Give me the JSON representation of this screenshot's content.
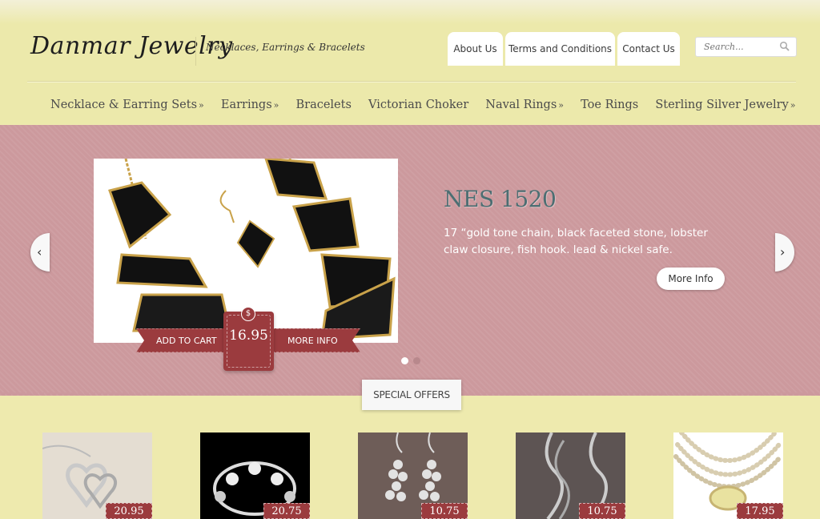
{
  "header": {
    "logo": "Danmar Jewelry",
    "tagline": "Necklaces, Earrings & Bracelets",
    "top_links": [
      "About Us",
      "Terms and Conditions",
      "Contact Us"
    ],
    "search_placeholder": "Search..."
  },
  "nav": {
    "items": [
      {
        "label": "Necklace & Earring Sets",
        "arrow": "»"
      },
      {
        "label": "Earrings",
        "arrow": "»"
      },
      {
        "label": "Bracelets",
        "arrow": ""
      },
      {
        "label": "Victorian Choker",
        "arrow": ""
      },
      {
        "label": "Naval Rings",
        "arrow": "»"
      },
      {
        "label": "Toe Rings",
        "arrow": ""
      },
      {
        "label": "Sterling Silver Jewelry",
        "arrow": "»"
      }
    ]
  },
  "slider": {
    "title": "NES 1520",
    "description": "17 “gold tone chain,  black faceted stone,  lobster claw closure, fish hook. lead & nickel safe.",
    "more_info_button": "More Info",
    "add_to_cart": "ADD TO CART",
    "more_info_ribbon": "MORE INFO",
    "price": "16.95",
    "currency_symbol": "$",
    "active_slide": 1,
    "slide_count": 2
  },
  "offers": {
    "tab_label": "SPECIAL OFFERS",
    "products": [
      {
        "price": "20.95",
        "image": "silver-heart-pendant"
      },
      {
        "price": "20.75",
        "image": "silver-flower-cuff-bracelet"
      },
      {
        "price": "10.75",
        "image": "silver-bead-cluster-earrings"
      },
      {
        "price": "10.75",
        "image": "silver-twist-drop-earrings"
      },
      {
        "price": "17.95",
        "image": "pearl-multistrand-necklace"
      }
    ]
  },
  "colors": {
    "background": "#eeeaae",
    "slider_bg": "#cc999d",
    "accent_red": "#9b3b3e",
    "title_teal": "#4c6e72"
  }
}
